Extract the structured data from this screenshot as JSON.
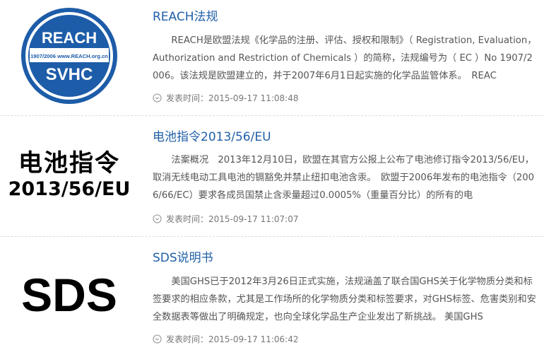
{
  "articles": [
    {
      "title": "REACH法规",
      "summary": "REACH是欧盟法规《化学品的注册、评估、授权和限制》（ Registration, Evaluation，Authorization and Restriction of Chemicals ）的简称，法规编号为（ EC ）No 1907/2006。该法规是欧盟建立的，并于2007年6月1日起实施的化学品监管体系。　REAC",
      "meta_label": "发表时间：",
      "date": "2015-09-17 11:08:48",
      "badge": {
        "top": "REACH",
        "middle": "1907/2006 www.REACH.org.cn",
        "bottom": "SVHC"
      }
    },
    {
      "title": "电池指令2013/56/EU",
      "summary": "法案概况　2013年12月10日，欧盟在其官方公报上公布了电池修订指令2013/56/EU，取消无线电动工具电池的镉豁免并禁止纽扣电池含汞。　欧盟于2006年发布的电池指令（2006/66/EC）要求各成员国禁止含汞量超过0.0005%（重量百分比）的所有的电",
      "meta_label": "发表时间：",
      "date": "2015-09-17 11:07:07",
      "thumb_line1": "电池指令",
      "thumb_line2": "2013/56/EU"
    },
    {
      "title": "SDS说明书",
      "summary": "美国GHS已于2012年3月26日正式实施，法规涵盖了联合国GHS关于化学物质分类和标签要求的相应条款，尤其是工作场所的化学物质分类和标签要求，对GHS标签、危害类别和安全数据表等做出了明确规定，也向全球化学品生产企业发出了新挑战。 美国GHS",
      "meta_label": "发表时间：",
      "date": "2015-09-17 11:06:42",
      "thumb_text": "SDS"
    }
  ],
  "colors": {
    "title": "#1f5fa8",
    "badge_blue": "#1d5ca8"
  }
}
